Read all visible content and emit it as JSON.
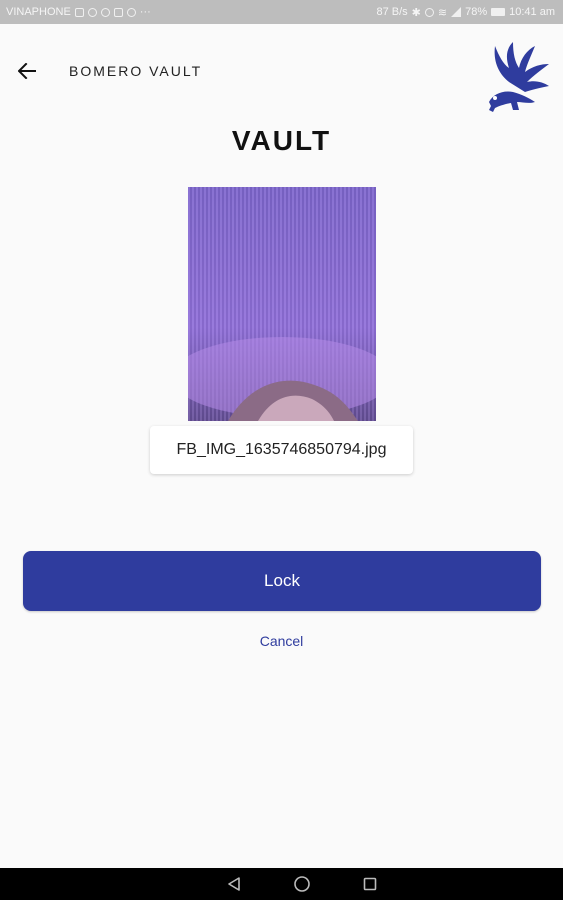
{
  "status_bar": {
    "carrier": "VINAPHONE",
    "network_speed": "87 B/s",
    "battery": "78%",
    "time": "10:41 am"
  },
  "app_bar": {
    "title": "BOMERO VAULT",
    "back_icon": "arrow-left-icon",
    "logo": "eagle-logo"
  },
  "page": {
    "title": "VAULT"
  },
  "file": {
    "name": "FB_IMG_1635746850794.jpg"
  },
  "actions": {
    "lock_label": "Lock",
    "cancel_label": "Cancel"
  },
  "colors": {
    "accent": "#2f3c9e",
    "background": "#fafafa",
    "status_bar": "#bdbdbd"
  },
  "nav_bar": {
    "icons": [
      "back-triangle-icon",
      "home-circle-icon",
      "recents-square-icon"
    ]
  }
}
